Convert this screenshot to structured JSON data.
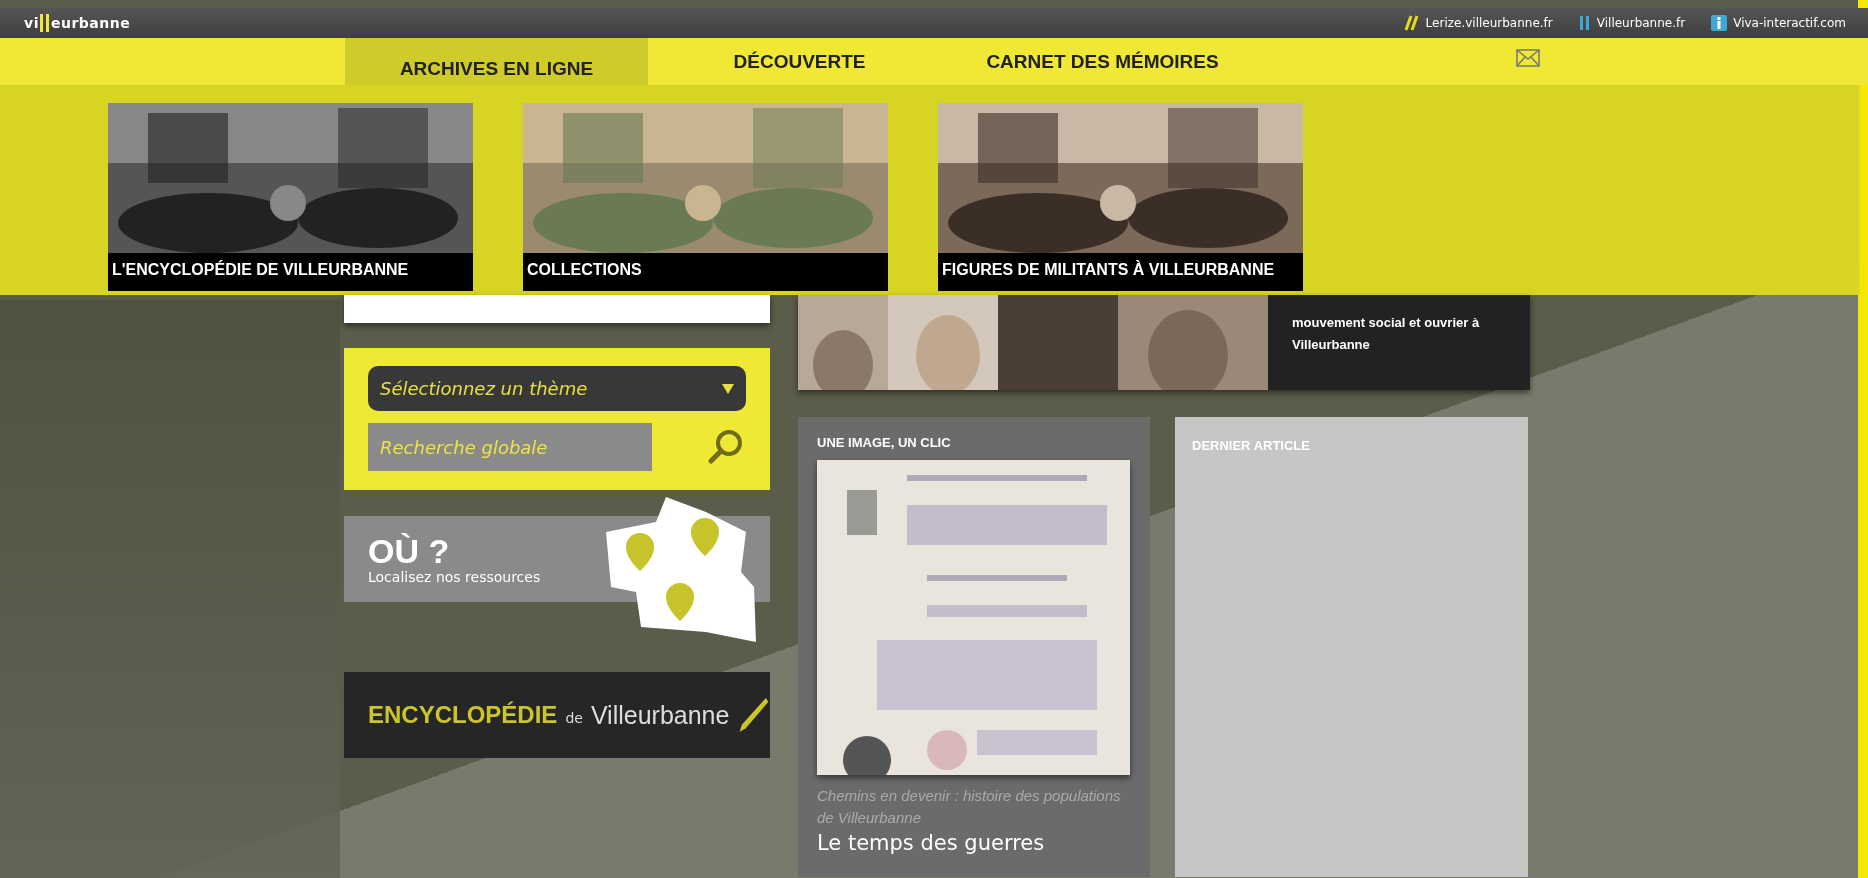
{
  "top_bar": {
    "logo": {
      "before": "vi",
      "after": "eurbanne"
    },
    "links": [
      {
        "label": "Lerize.villeurbanne.fr",
        "kind": "slashes"
      },
      {
        "label": "Villeurbanne.fr",
        "kind": "bars"
      },
      {
        "label": "Viva-interactif.com",
        "kind": "info"
      }
    ]
  },
  "nav": {
    "tabs": [
      {
        "label": "ARCHIVES EN LIGNE",
        "selected": true
      },
      {
        "label": "DÉCOUVERTE",
        "selected": false
      },
      {
        "label": "CARNET DES MÉMOIRES",
        "selected": false
      }
    ]
  },
  "menu_tiles": [
    {
      "label": "L'ENCYCLOPÉDIE DE VILLEURBANNE",
      "kind": "picture"
    },
    {
      "label": "COLLECTIONS",
      "kind": "picture"
    },
    {
      "label": "FIGURES DE MILITANTS À VILLEURBANNE",
      "kind": "picture"
    }
  ],
  "search": {
    "theme_select": "Sélectionnez un thème",
    "placeholder": "Recherche globale"
  },
  "where": {
    "title": "OÙ ?",
    "subtitle": "Localisez nos ressources"
  },
  "encyclopedia": {
    "bold": "ENCYCLOPÉDIE",
    "small": "de",
    "name": "Villeurbanne"
  },
  "news": {
    "text": "mouvement social et ouvrier à Villeurbanne"
  },
  "image_card": {
    "heading": "UNE IMAGE, UN CLIC",
    "caption": "Chemins en devenir : histoire des populations de Villeurbanne",
    "title": "Le temps des guerres"
  },
  "article_card": {
    "heading": "DERNIER ARTICLE"
  }
}
